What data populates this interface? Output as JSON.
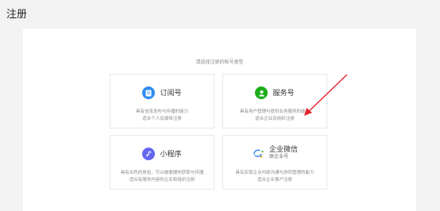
{
  "page": {
    "title": "注册"
  },
  "panel": {
    "subtitle": "请选择注册的帐号类型"
  },
  "cards": [
    {
      "name": "订阅号",
      "icon": "document-icon",
      "color": "#2d8cf0",
      "desc1": "具有信息发布与传播的能力",
      "desc2": "适合个人及媒体注册"
    },
    {
      "name": "服务号",
      "icon": "person-icon",
      "color": "#1aad19",
      "desc1": "具有用户管理与提供业务服务的能力",
      "desc2": "适合企业及组织注册"
    },
    {
      "name": "小程序",
      "icon": "link-icon",
      "color": "#6467f0",
      "desc1": "具有出色的体验，可以被便捷地获取与传播",
      "desc2": "适合有服务内容的企业和组织注册"
    },
    {
      "name": "企业微信",
      "subname": "原企业号",
      "icon": "wework-icon",
      "color": "#2d8cf0",
      "desc1": "具有实现企业内部沟通与协同管理的能力",
      "desc2": "适合企业客户注册"
    }
  ],
  "annotation": {
    "arrow_color": "#e8232b"
  }
}
